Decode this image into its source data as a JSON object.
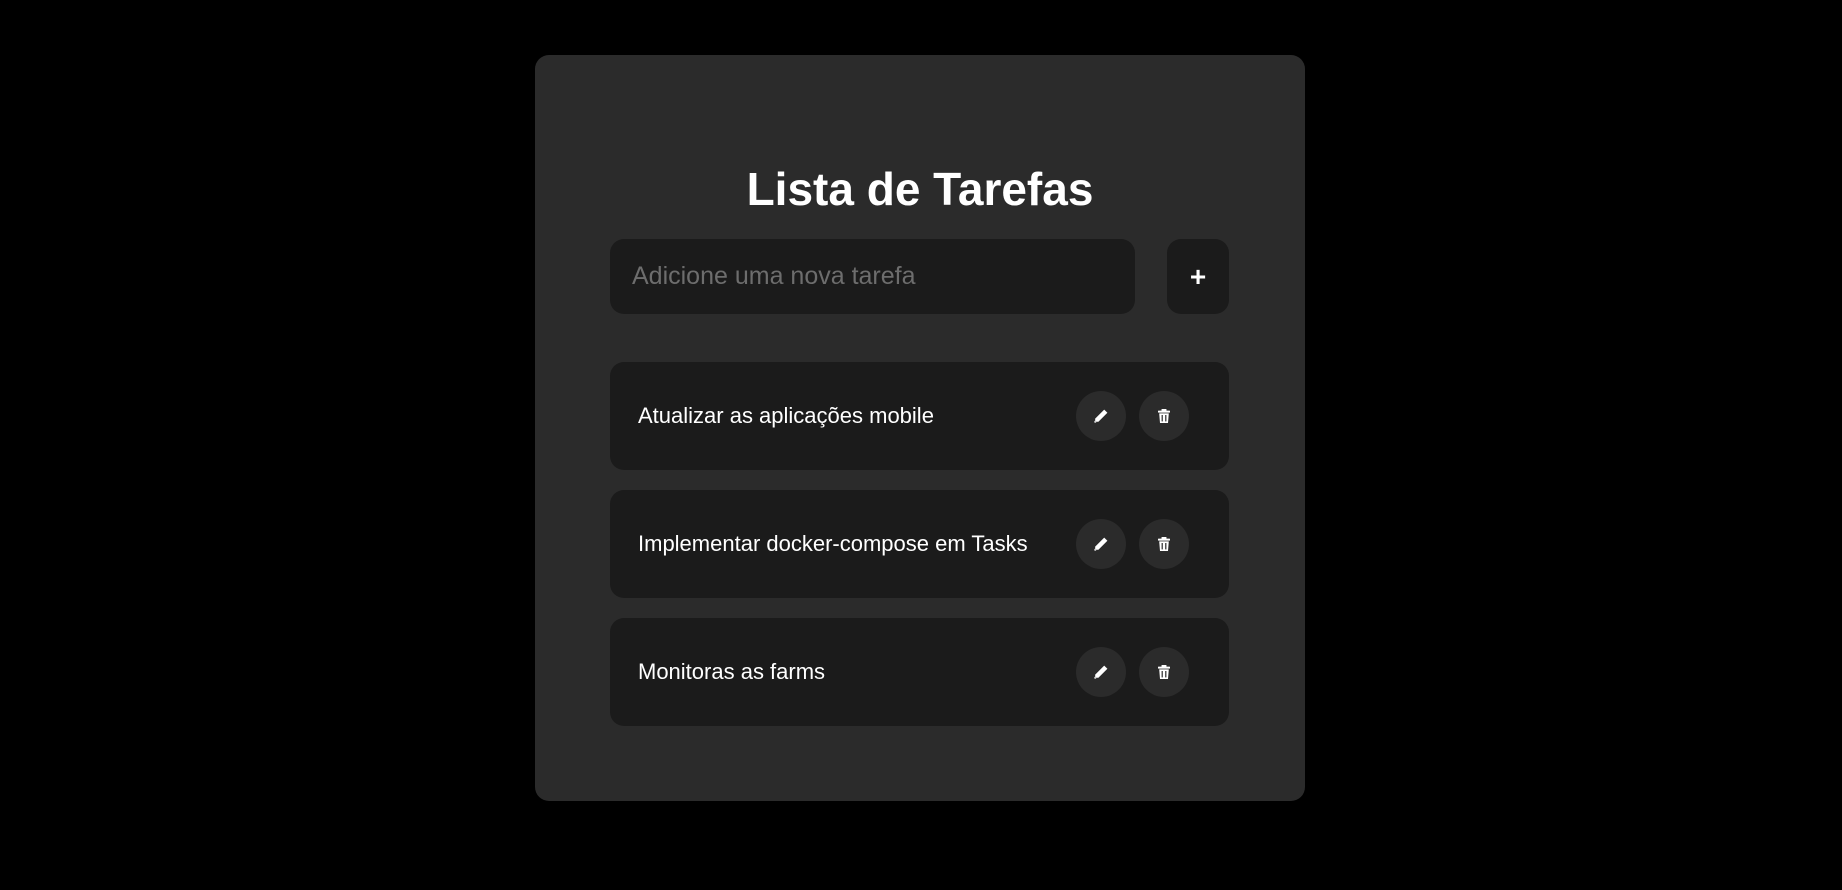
{
  "app": {
    "title": "Lista de Tarefas"
  },
  "new_task": {
    "value": "",
    "placeholder": "Adicione uma nova tarefa",
    "add_label": "+"
  },
  "tasks": [
    {
      "text": "Atualizar as aplicações mobile",
      "edit_icon": "pencil-icon",
      "delete_icon": "trash-icon"
    },
    {
      "text": "Implementar docker-compose em Tasks",
      "edit_icon": "pencil-icon",
      "delete_icon": "trash-icon"
    },
    {
      "text": "Monitoras as farms",
      "edit_icon": "pencil-icon",
      "delete_icon": "trash-icon"
    }
  ],
  "colors": {
    "page_background": "#000000",
    "card_background": "#2b2b2b",
    "field_background": "#1b1b1b",
    "text": "#ffffff",
    "placeholder": "#6d6d6d"
  }
}
